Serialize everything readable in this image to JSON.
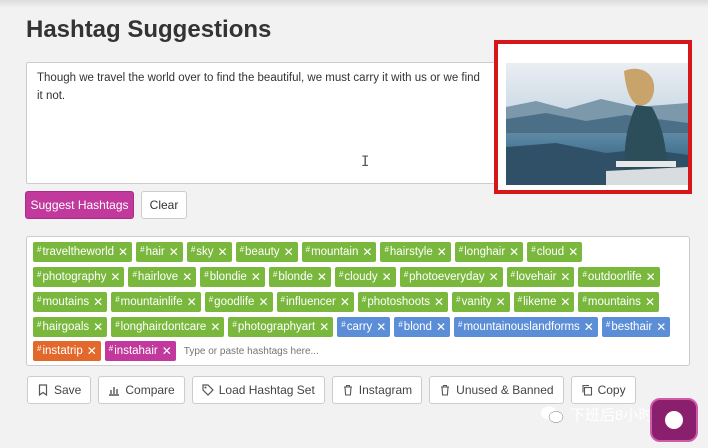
{
  "page": {
    "title": "Hashtag Suggestions",
    "caption_text": "Though we travel the world over to find the beautiful, we must carry it with us or we find it not."
  },
  "buttons": {
    "suggest": "Suggest Hashtags",
    "clear": "Clear"
  },
  "tag_rows": [
    [
      {
        "text": "traveltheworld",
        "color": "green"
      },
      {
        "text": "hair",
        "color": "green"
      },
      {
        "text": "sky",
        "color": "green"
      },
      {
        "text": "beauty",
        "color": "green"
      },
      {
        "text": "mountain",
        "color": "green"
      },
      {
        "text": "hairstyle",
        "color": "green"
      },
      {
        "text": "longhair",
        "color": "green"
      },
      {
        "text": "cloud",
        "color": "green"
      }
    ],
    [
      {
        "text": "photography",
        "color": "green"
      },
      {
        "text": "hairlove",
        "color": "green"
      },
      {
        "text": "blondie",
        "color": "green"
      },
      {
        "text": "blonde",
        "color": "green"
      },
      {
        "text": "cloudy",
        "color": "green"
      },
      {
        "text": "photoeveryday",
        "color": "green"
      },
      {
        "text": "lovehair",
        "color": "green"
      },
      {
        "text": "outdoorlife",
        "color": "green"
      }
    ],
    [
      {
        "text": "moutains",
        "color": "green"
      },
      {
        "text": "mountainlife",
        "color": "green"
      },
      {
        "text": "goodlife",
        "color": "green"
      },
      {
        "text": "influencer",
        "color": "green"
      },
      {
        "text": "photoshoots",
        "color": "green"
      },
      {
        "text": "vanity",
        "color": "green"
      },
      {
        "text": "likeme",
        "color": "green"
      },
      {
        "text": "mountains",
        "color": "green"
      }
    ],
    [
      {
        "text": "hairgoals",
        "color": "green"
      },
      {
        "text": "longhairdontcare",
        "color": "green"
      },
      {
        "text": "photographyart",
        "color": "green"
      },
      {
        "text": "carry",
        "color": "blue"
      },
      {
        "text": "blond",
        "color": "blue"
      },
      {
        "text": "mountainouslandforms",
        "color": "blue"
      },
      {
        "text": "besthair",
        "color": "blue"
      }
    ],
    [
      {
        "text": "instatrip",
        "color": "orange"
      },
      {
        "text": "instahair",
        "color": "magenta"
      }
    ]
  ],
  "tag_input": {
    "placeholder": "Type or paste hashtags here..."
  },
  "tools": [
    {
      "icon": "bookmark-icon",
      "label": "Save"
    },
    {
      "icon": "bar-chart-icon",
      "label": "Compare"
    },
    {
      "icon": "tag-icon",
      "label": "Load Hashtag Set"
    },
    {
      "icon": "trash-icon",
      "label": "Instagram"
    },
    {
      "icon": "trash-icon",
      "label": "Unused & Banned"
    },
    {
      "icon": "copy-icon",
      "label": "Copy"
    }
  ],
  "watermark": {
    "text": "下班后8小时"
  },
  "colors": {
    "green": "#7ab83d",
    "blue": "#5b8ed6",
    "orange": "#e2692b",
    "magenta": "#c1399c",
    "frame_red": "#d6161b"
  }
}
